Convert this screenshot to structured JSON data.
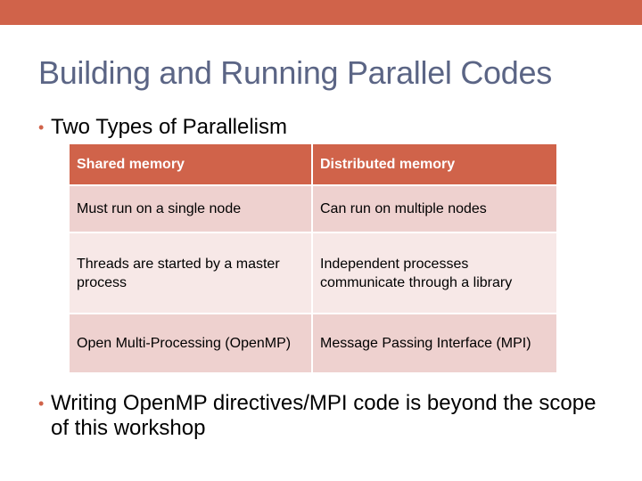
{
  "slide": {
    "title": "Building and Running Parallel Codes",
    "bullets": [
      "Two Types of Parallelism",
      "Writing OpenMP directives/MPI code is beyond the scope of this workshop"
    ],
    "table": {
      "headers": [
        "Shared memory",
        "Distributed memory"
      ],
      "rows": [
        [
          "Must run on a single node",
          "Can run on multiple nodes"
        ],
        [
          "Threads are started by a master process",
          "Independent processes communicate through a library"
        ],
        [
          "Open Multi-Processing (OpenMP)",
          "Message Passing Interface (MPI)"
        ]
      ]
    }
  },
  "colors": {
    "accent": "#d0634a",
    "title": "#5b6585",
    "row_dark": "#eed1cf",
    "row_light": "#f7e8e7"
  }
}
